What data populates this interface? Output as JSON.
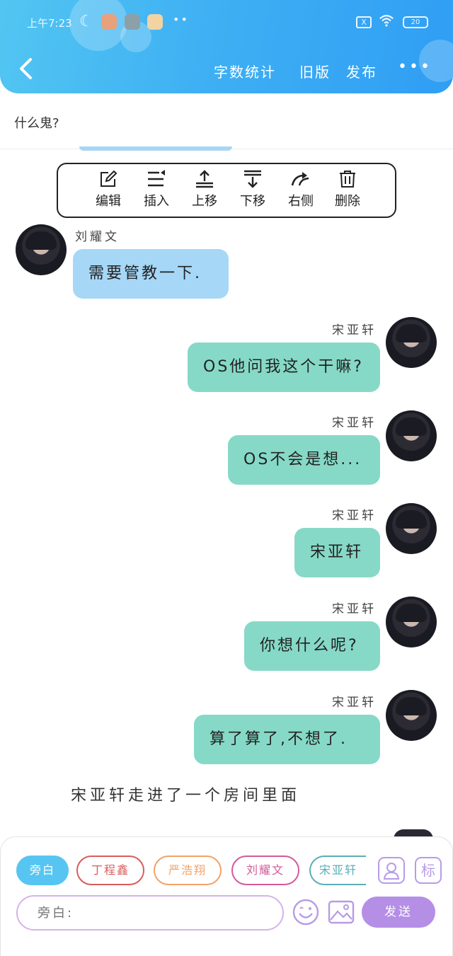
{
  "status_bar": {
    "time": "上午7:23",
    "sim_label": "X",
    "battery_label": "20"
  },
  "header": {
    "word_count": "字数统计",
    "old_version": "旧版",
    "publish": "发布",
    "more": "•••"
  },
  "top_snippet": "什么鬼?",
  "toolbar": {
    "items": [
      {
        "label": "编辑",
        "icon": "edit-icon"
      },
      {
        "label": "插入",
        "icon": "insert-icon"
      },
      {
        "label": "上移",
        "icon": "move-up-icon"
      },
      {
        "label": "下移",
        "icon": "move-down-icon"
      },
      {
        "label": "右侧",
        "icon": "right-side-icon"
      },
      {
        "label": "删除",
        "icon": "delete-icon"
      }
    ]
  },
  "messages": [
    {
      "sender": "刘耀文",
      "text": "需要管教一下.",
      "side": "left",
      "color": "#a6d7f6"
    },
    {
      "sender": "宋亚轩",
      "text": "OS他问我这个干嘛?",
      "side": "right",
      "color": "#86d9c7"
    },
    {
      "sender": "宋亚轩",
      "text": "OS不会是想...",
      "side": "right",
      "color": "#86d9c7"
    },
    {
      "sender": "宋亚轩",
      "text": "宋亚轩",
      "side": "right",
      "color": "#86d9c7"
    },
    {
      "sender": "宋亚轩",
      "text": "你想什么呢?",
      "side": "right",
      "color": "#86d9c7"
    },
    {
      "sender": "宋亚轩",
      "text": "算了算了,不想了.",
      "side": "right",
      "color": "#86d9c7"
    }
  ],
  "narration": "宋亚轩走进了一个房间里面",
  "composer": {
    "roles": [
      "旁白",
      "丁程鑫",
      "严浩翔",
      "刘耀文",
      "宋亚轩"
    ],
    "role_colors": [
      "#57c5f2",
      "#d95c5c",
      "#f0a36a",
      "#d35a9a",
      "#5aaeb8"
    ],
    "input_placeholder": "旁白:",
    "send_label": "发送",
    "tag_button": "标"
  }
}
